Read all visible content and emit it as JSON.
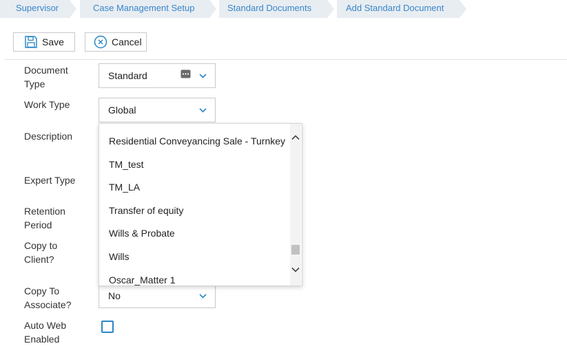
{
  "breadcrumb": [
    "Supervisor",
    "Case Management Setup",
    "Standard Documents",
    "Add Standard Document"
  ],
  "toolbar": {
    "save_label": "Save",
    "cancel_label": "Cancel"
  },
  "form": {
    "document_type": {
      "label": "Document Type",
      "value": "Standard"
    },
    "work_type": {
      "label": "Work Type",
      "value": "Global"
    },
    "description": {
      "label": "Description"
    },
    "expert_type": {
      "label": "Expert Type"
    },
    "retention_period": {
      "label": "Retention Period"
    },
    "copy_to_client": {
      "label": "Copy to Client?"
    },
    "copy_to_associate": {
      "label": "Copy To Associate?",
      "value": "No"
    },
    "auto_web_enabled": {
      "label": "Auto Web Enabled",
      "checked": false
    }
  },
  "dropdown": {
    "options": [
      "Residential Conveyancing Sale - Turnkey",
      "TM_test",
      "TM_LA",
      "Transfer of equity",
      "Wills & Probate",
      "Wills",
      "Oscar_Matter 1"
    ]
  },
  "colors": {
    "accent": "#2a87c6",
    "breadcrumb_bg": "#e8edf2",
    "link": "#3a86c8"
  }
}
